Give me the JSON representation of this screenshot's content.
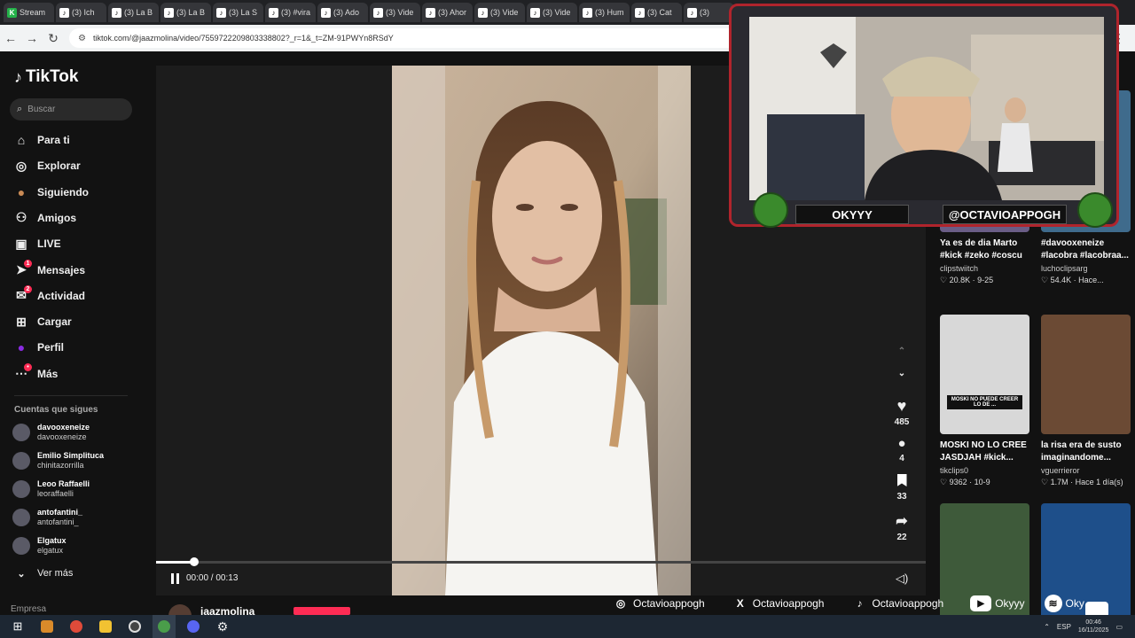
{
  "browser": {
    "tabs": [
      {
        "title": "Stream",
        "kind": "twitch"
      },
      {
        "title": "(3) Ich",
        "kind": "tiktok"
      },
      {
        "title": "(3) La B",
        "kind": "tiktok"
      },
      {
        "title": "(3) La B",
        "kind": "tiktok"
      },
      {
        "title": "(3) La S",
        "kind": "tiktok"
      },
      {
        "title": "(3) #vira",
        "kind": "tiktok"
      },
      {
        "title": "(3) Ado",
        "kind": "tiktok"
      },
      {
        "title": "(3) Vide",
        "kind": "tiktok"
      },
      {
        "title": "(3) Ahor",
        "kind": "tiktok"
      },
      {
        "title": "(3) Vide",
        "kind": "tiktok"
      },
      {
        "title": "(3) Vide",
        "kind": "tiktok"
      },
      {
        "title": "(3) Hum",
        "kind": "tiktok"
      },
      {
        "title": "(3) Cat",
        "kind": "tiktok"
      },
      {
        "title": "(3)",
        "kind": "tiktok"
      }
    ],
    "url": "tiktok.com/@jaazmolina/video/7559722209803338802?_r=1&_t=ZM-91PWYn8RSdY"
  },
  "tiktok": {
    "logo": "TikTok",
    "search_placeholder": "Buscar",
    "nav": [
      {
        "label": "Para ti",
        "icon": "home-icon",
        "badge": ""
      },
      {
        "label": "Explorar",
        "icon": "compass-icon",
        "badge": ""
      },
      {
        "label": "Siguiendo",
        "icon": "following-icon",
        "badge": ""
      },
      {
        "label": "Amigos",
        "icon": "friends-icon",
        "badge": ""
      },
      {
        "label": "LIVE",
        "icon": "live-icon",
        "badge": ""
      },
      {
        "label": "Mensajes",
        "icon": "messages-icon",
        "badge": "1"
      },
      {
        "label": "Actividad",
        "icon": "activity-icon",
        "badge": "2"
      },
      {
        "label": "Cargar",
        "icon": "upload-icon",
        "badge": ""
      },
      {
        "label": "Perfil",
        "icon": "profile-icon",
        "badge": ""
      },
      {
        "label": "Más",
        "icon": "more-icon",
        "badge": "•"
      }
    ],
    "following_title": "Cuentas que sigues",
    "accounts": [
      {
        "name": "davooxeneize",
        "handle": "davooxeneize"
      },
      {
        "name": "Emilio Simplituca",
        "handle": "chinitazorrilla"
      },
      {
        "name": "Leoo Raffaelli",
        "handle": "leoraffaelli"
      },
      {
        "name": "antofantini_",
        "handle": "antofantini_"
      },
      {
        "name": "Elgatux",
        "handle": "elgatux"
      }
    ],
    "see_more": "Ver más",
    "company": "Empresa",
    "player": {
      "time": "00:00 / 00:13",
      "progress": 0.05,
      "author": "jaazmolina"
    },
    "actions": {
      "likes": "485",
      "comments": "4",
      "saves": "33",
      "shares": "22"
    },
    "related": [
      {
        "title": "Ya es de dia Marto #kick #zeko #coscu",
        "user": "clipstwiitch",
        "likes": "20.8K",
        "date": "9-25",
        "thumb_color": "#6a5d86"
      },
      {
        "title": "#davooxeneize #lacobra #lacobraa...",
        "user": "luchoclipsarg",
        "likes": "54.4K",
        "date": "Hace...",
        "thumb_color": "#3f6b8c"
      },
      {
        "title": "MOSKI NO LO CREE JASDJAH #kick...",
        "user": "tikclips0",
        "likes": "9362",
        "date": "10-9",
        "thumb_color": "#d8d8d8",
        "thumb_text": "MOSKI NO PUEDE CREER LO DE ..."
      },
      {
        "title": "la risa era de susto imaginandome...",
        "user": "vguerrieror",
        "likes": "1.7M",
        "date": "Hace 1 día(s)",
        "thumb_color": "#6b4a34"
      },
      {
        "title": "",
        "user": "",
        "likes": "",
        "date": "",
        "thumb_color": "#3e5a3a"
      },
      {
        "title": "",
        "user": "",
        "likes": "",
        "date": "",
        "thumb_color": "#1e4f8a"
      }
    ]
  },
  "stream_overlay": {
    "name_left": "OKYYY",
    "name_right": "@OCTAVIOAPPOGH"
  },
  "socials": [
    {
      "icon": "instagram-icon",
      "label": "Octavioappogh"
    },
    {
      "icon": "x-icon",
      "label": "Octavioappogh"
    },
    {
      "icon": "tiktok-icon",
      "label": "Octavioappogh"
    },
    {
      "icon": "youtube-icon",
      "label": "Okyyy"
    },
    {
      "icon": "spotify-icon",
      "label": "Oky"
    }
  ],
  "taskbar": {
    "lang": "ESP",
    "time": "00:46",
    "date": "16/11/2025"
  },
  "colors": {
    "accent": "#fe2c55",
    "overlay_border": "#b0242c"
  }
}
